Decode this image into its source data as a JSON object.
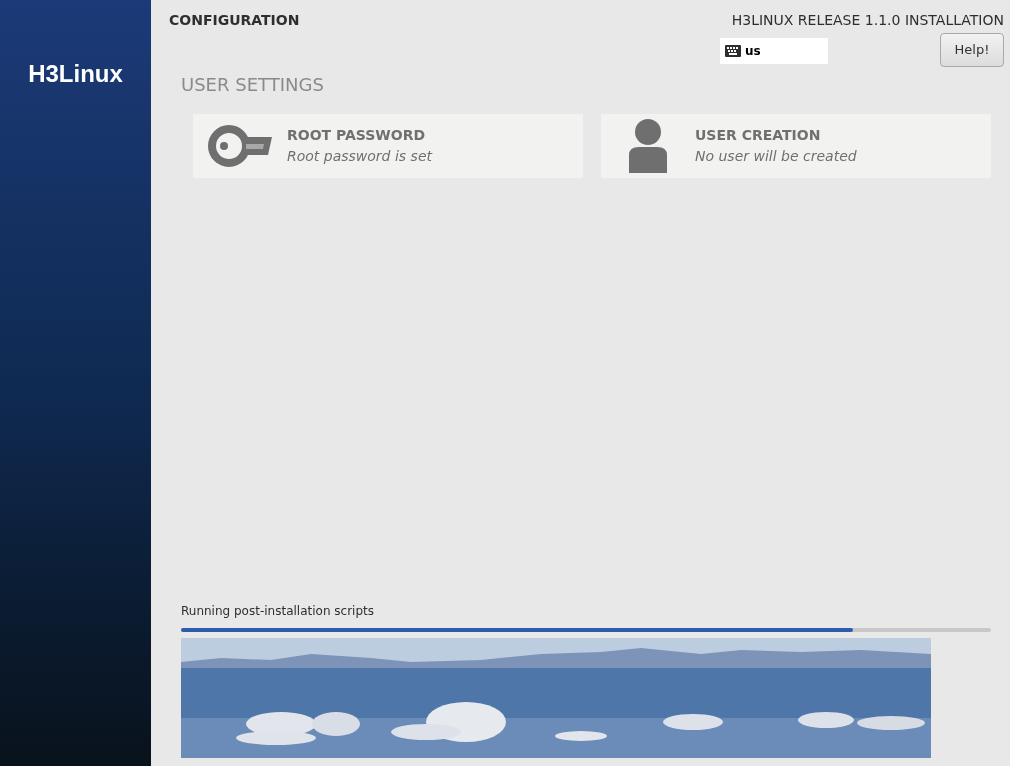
{
  "sidebar": {
    "logo": "H3Linux"
  },
  "header": {
    "title": "CONFIGURATION",
    "product": "H3LINUX RELEASE 1.1.0 INSTALLATION",
    "keyboard_layout": "us",
    "help_button": "Help!"
  },
  "section": {
    "title": "USER SETTINGS",
    "spokes": [
      {
        "kind": "key",
        "title": "ROOT PASSWORD",
        "status": "Root password is set"
      },
      {
        "kind": "user",
        "title": "USER CREATION",
        "status": "No user will be created"
      }
    ]
  },
  "progress": {
    "label": "Running post-installation scripts",
    "level": 0.83
  }
}
